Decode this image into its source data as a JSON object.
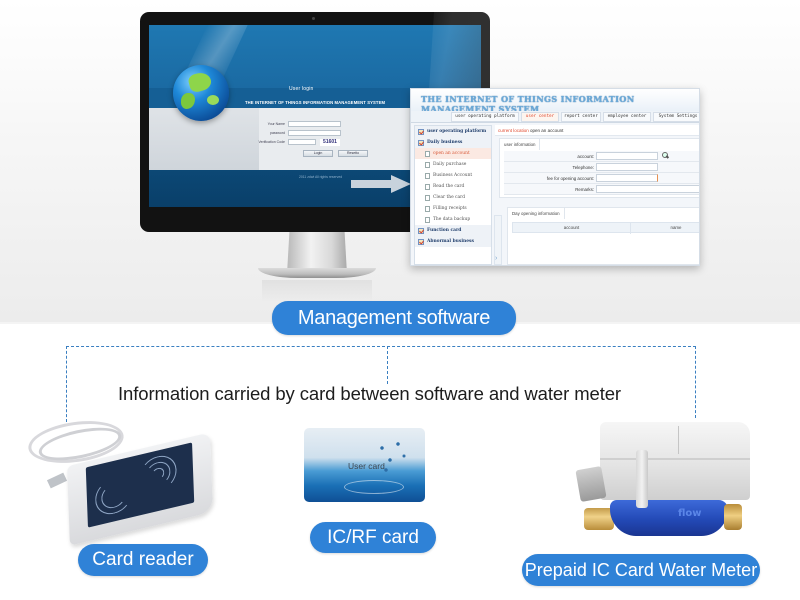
{
  "login_screen": {
    "heading": "User login",
    "system_title": "THE INTERNET OF THINGS INFORMATION MANAGEMENT SYSTEM",
    "fields": [
      {
        "label": "Your Name",
        "value": ""
      },
      {
        "label": "password",
        "value": ""
      },
      {
        "label": "Verification Code",
        "value": ""
      }
    ],
    "captcha": "51601",
    "buttons": {
      "login": "Login",
      "reset": "Resetto"
    },
    "copyright": "2011 zdwt All rights reserved"
  },
  "app": {
    "title": "THE INTERNET OF THINGS INFORMATION MANAGEMENT SYSTEM",
    "tabs": [
      {
        "label": "user operating platform",
        "active": false
      },
      {
        "label": "user center",
        "active": true
      },
      {
        "label": "report center",
        "active": false
      },
      {
        "label": "employee center",
        "active": false
      },
      {
        "label": "System Settings",
        "active": false
      }
    ],
    "sidebar": [
      {
        "label": "user operating platform",
        "type": "head"
      },
      {
        "label": "Daily business",
        "type": "head"
      },
      {
        "label": "open an account",
        "type": "sub",
        "selected": true
      },
      {
        "label": "Daily purchase",
        "type": "sub"
      },
      {
        "label": "Business Account",
        "type": "sub"
      },
      {
        "label": "Read the card",
        "type": "sub"
      },
      {
        "label": "Clear the card",
        "type": "sub"
      },
      {
        "label": "Filling receipts",
        "type": "sub"
      },
      {
        "label": "The data backup",
        "type": "sub"
      },
      {
        "label": "Function card",
        "type": "head"
      },
      {
        "label": "Abnormal business",
        "type": "head"
      }
    ],
    "location": {
      "prefix": "current location",
      "page": "open an account"
    },
    "user_info": {
      "tab": "user information",
      "fields": [
        {
          "label": "account:",
          "value": ""
        },
        {
          "label": "Telephone:",
          "value": ""
        },
        {
          "label": "fee for opening account:",
          "value": ""
        },
        {
          "label": "Remarks:",
          "value": ""
        }
      ]
    },
    "day_opening": {
      "tab": "Day opening information",
      "columns": [
        "account",
        "name"
      ]
    },
    "expander_glyph": "›"
  },
  "labels": {
    "management_software": "Management software",
    "info_text": "Information carried by card between software and water meter",
    "card_reader": "Card reader",
    "ic_card": "IC/RF card",
    "ic_card_print": "User card",
    "water_meter": "Prepaid IC Card Water Meter",
    "meter_emboss": "flow"
  },
  "colors": {
    "badge_blue": "#2f82d7",
    "dash_blue": "#3a7fc1",
    "active_tab": "#e0482d"
  }
}
